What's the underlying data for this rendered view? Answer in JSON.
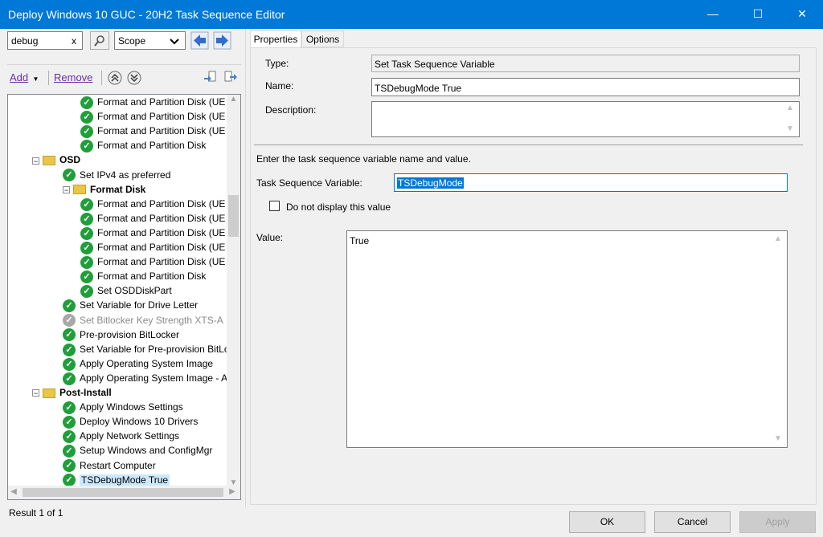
{
  "window": {
    "title": "Deploy Windows 10 GUC - 20H2 Task Sequence Editor",
    "minimize": "—",
    "maximize": "☐",
    "close": "✕"
  },
  "search": {
    "value": "debug",
    "clear": "x",
    "scope_value": "Scope"
  },
  "toolbar": {
    "add_label": "Add",
    "remove_label": "Remove"
  },
  "tree": [
    {
      "label": "Format and Partition Disk (UE",
      "indent": 3,
      "icon": "ok"
    },
    {
      "label": "Format and Partition Disk (UE",
      "indent": 3,
      "icon": "ok"
    },
    {
      "label": "Format and Partition Disk (UE",
      "indent": 3,
      "icon": "ok"
    },
    {
      "label": "Format and Partition Disk",
      "indent": 3,
      "icon": "ok"
    },
    {
      "label": "OSD",
      "indent": 1,
      "icon": "folder",
      "bold": true,
      "expand": "−"
    },
    {
      "label": "Set IPv4 as preferred",
      "indent": 2,
      "icon": "ok"
    },
    {
      "label": "Format Disk",
      "indent": 2,
      "icon": "folder",
      "bold": true,
      "expand": "−"
    },
    {
      "label": "Format and Partition Disk (UE",
      "indent": 3,
      "icon": "ok"
    },
    {
      "label": "Format and Partition Disk (UE",
      "indent": 3,
      "icon": "ok"
    },
    {
      "label": "Format and Partition Disk (UE",
      "indent": 3,
      "icon": "ok"
    },
    {
      "label": "Format and Partition Disk (UE",
      "indent": 3,
      "icon": "ok"
    },
    {
      "label": "Format and Partition Disk (UE",
      "indent": 3,
      "icon": "ok"
    },
    {
      "label": "Format and Partition Disk",
      "indent": 3,
      "icon": "ok"
    },
    {
      "label": "Set OSDDiskPart",
      "indent": 3,
      "icon": "ok"
    },
    {
      "label": "Set Variable for Drive Letter",
      "indent": 2,
      "icon": "ok"
    },
    {
      "label": "Set Bitlocker Key Strength XTS-A",
      "indent": 2,
      "icon": "disabled"
    },
    {
      "label": "Pre-provision BitLocker",
      "indent": 2,
      "icon": "ok"
    },
    {
      "label": "Set Variable for Pre-provision BitLo",
      "indent": 2,
      "icon": "ok"
    },
    {
      "label": "Apply Operating System Image",
      "indent": 2,
      "icon": "ok"
    },
    {
      "label": "Apply Operating System Image - A",
      "indent": 2,
      "icon": "ok"
    },
    {
      "label": "Post-Install",
      "indent": 1,
      "icon": "folder",
      "bold": true,
      "expand": "−"
    },
    {
      "label": "Apply Windows Settings",
      "indent": 2,
      "icon": "ok"
    },
    {
      "label": "Deploy Windows 10 Drivers",
      "indent": 2,
      "icon": "ok"
    },
    {
      "label": "Apply Network Settings",
      "indent": 2,
      "icon": "ok"
    },
    {
      "label": "Setup Windows and ConfigMgr",
      "indent": 2,
      "icon": "ok"
    },
    {
      "label": "Restart Computer",
      "indent": 2,
      "icon": "ok"
    },
    {
      "label": "TSDebugMode True",
      "indent": 2,
      "icon": "ok",
      "selected": true
    }
  ],
  "status": {
    "result": "Result 1 of 1"
  },
  "tabs": [
    {
      "label": "Properties",
      "active": true
    },
    {
      "label": "Options",
      "active": false
    }
  ],
  "properties": {
    "type_label": "Type:",
    "type_value": "Set Task Sequence Variable",
    "name_label": "Name:",
    "name_value": "TSDebugMode True",
    "description_label": "Description:",
    "description_value": "",
    "instructions": "Enter the task sequence variable name and value.",
    "variable_label": "Task Sequence Variable:",
    "variable_value": "TSDebugMode",
    "checkbox_label": "Do not display this value",
    "checkbox_checked": false,
    "value_label": "Value:",
    "value_value": "True"
  },
  "buttons": {
    "ok": "OK",
    "cancel": "Cancel",
    "apply": "Apply"
  },
  "colors": {
    "titlebar": "#0078d7",
    "selection": "#cce8ff",
    "ok_icon": "#1f9e3a"
  }
}
